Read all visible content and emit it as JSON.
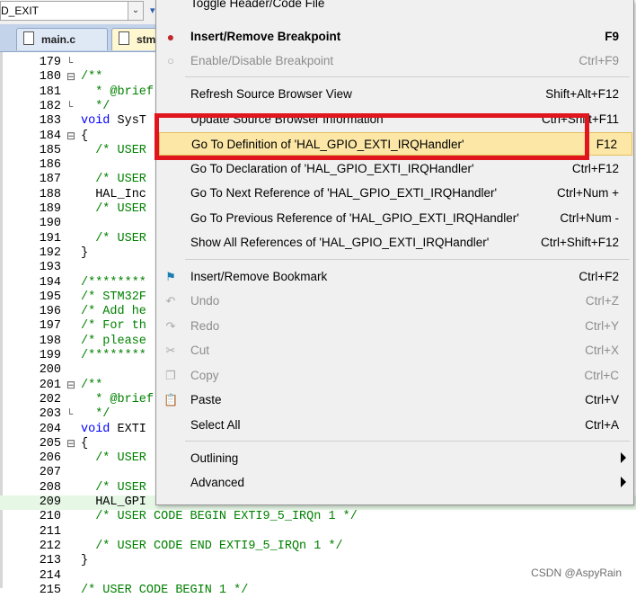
{
  "toolbar": {
    "combo_value": "D_EXIT",
    "combo_arrow": "chevron-down-icon"
  },
  "tabs": [
    {
      "label": "main.c",
      "icon": "document-icon"
    },
    {
      "label": "stm",
      "icon": "document-icon"
    }
  ],
  "code_lines": [
    {
      "n": "179",
      "fold": "└",
      "text": ""
    },
    {
      "n": "180",
      "fold": "⊟",
      "text": "/**"
    },
    {
      "n": "181",
      "fold": "",
      "text": "  * @brief"
    },
    {
      "n": "182",
      "fold": "└",
      "text": "  */"
    },
    {
      "n": "183",
      "fold": "",
      "text": "void SysT"
    },
    {
      "n": "184",
      "fold": "⊟",
      "text": "{"
    },
    {
      "n": "185",
      "fold": "",
      "text": "  /* USER"
    },
    {
      "n": "186",
      "fold": "",
      "text": ""
    },
    {
      "n": "187",
      "fold": "",
      "text": "  /* USER"
    },
    {
      "n": "188",
      "fold": "",
      "text": "  HAL_Inc"
    },
    {
      "n": "189",
      "fold": "",
      "text": "  /* USER"
    },
    {
      "n": "190",
      "fold": "",
      "text": ""
    },
    {
      "n": "191",
      "fold": "",
      "text": "  /* USER"
    },
    {
      "n": "192",
      "fold": "",
      "text": "}"
    },
    {
      "n": "193",
      "fold": "",
      "text": ""
    },
    {
      "n": "194",
      "fold": "",
      "text": "/********"
    },
    {
      "n": "195",
      "fold": "",
      "text": "/* STM32F"
    },
    {
      "n": "196",
      "fold": "",
      "text": "/* Add he"
    },
    {
      "n": "197",
      "fold": "",
      "text": "/* For th"
    },
    {
      "n": "198",
      "fold": "",
      "text": "/* please"
    },
    {
      "n": "199",
      "fold": "",
      "text": "/********"
    },
    {
      "n": "200",
      "fold": "",
      "text": ""
    },
    {
      "n": "201",
      "fold": "⊟",
      "text": "/**"
    },
    {
      "n": "202",
      "fold": "",
      "text": "  * @brief"
    },
    {
      "n": "203",
      "fold": "└",
      "text": "  */"
    },
    {
      "n": "204",
      "fold": "",
      "text": "void EXTI"
    },
    {
      "n": "205",
      "fold": "⊟",
      "text": "{"
    },
    {
      "n": "206",
      "fold": "",
      "text": "  /* USER"
    },
    {
      "n": "207",
      "fold": "",
      "text": ""
    },
    {
      "n": "208",
      "fold": "",
      "text": "  /* USER"
    },
    {
      "n": "209",
      "fold": "",
      "text": "  HAL_GPI"
    },
    {
      "n": "210",
      "fold": "",
      "text": "  /* USER CODE BEGIN EXTI9_5_IRQn 1 */"
    },
    {
      "n": "211",
      "fold": "",
      "text": ""
    },
    {
      "n": "212",
      "fold": "",
      "text": "  /* USER CODE END EXTI9_5_IRQn 1 */"
    },
    {
      "n": "213",
      "fold": "",
      "text": "}"
    },
    {
      "n": "214",
      "fold": "",
      "text": ""
    },
    {
      "n": "215",
      "fold": "",
      "text": "/* USER CODE BEGIN 1 */"
    }
  ],
  "menu": {
    "items": [
      {
        "label": "Toggle Header/Code File",
        "shortcut": ""
      },
      {
        "label": "Insert/Remove Breakpoint",
        "shortcut": "F9",
        "icon": "breakpoint-icon"
      },
      {
        "label": "Enable/Disable Breakpoint",
        "shortcut": "Ctrl+F9",
        "icon": "breakpoint-disabled-icon"
      },
      {
        "label": "Refresh Source Browser View",
        "shortcut": "Shift+Alt+F12"
      },
      {
        "label": "Update Source Browser Information",
        "shortcut": "Ctrl+Shift+F11"
      },
      {
        "label": "Go To Definition of 'HAL_GPIO_EXTI_IRQHandler'",
        "shortcut": "F12"
      },
      {
        "label": "Go To Declaration of 'HAL_GPIO_EXTI_IRQHandler'",
        "shortcut": "Ctrl+F12"
      },
      {
        "label": "Go To Next Reference of 'HAL_GPIO_EXTI_IRQHandler'",
        "shortcut": "Ctrl+Num +"
      },
      {
        "label": "Go To Previous Reference of 'HAL_GPIO_EXTI_IRQHandler'",
        "shortcut": "Ctrl+Num -"
      },
      {
        "label": "Show All References of 'HAL_GPIO_EXTI_IRQHandler'",
        "shortcut": "Ctrl+Shift+F12"
      },
      {
        "label": "Insert/Remove Bookmark",
        "shortcut": "Ctrl+F2",
        "icon": "bookmark-flag-icon"
      },
      {
        "label": "Undo",
        "shortcut": "Ctrl+Z",
        "icon": "undo-icon"
      },
      {
        "label": "Redo",
        "shortcut": "Ctrl+Y",
        "icon": "redo-icon"
      },
      {
        "label": "Cut",
        "shortcut": "Ctrl+X",
        "icon": "scissors-icon"
      },
      {
        "label": "Copy",
        "shortcut": "Ctrl+C",
        "icon": "copy-icon"
      },
      {
        "label": "Paste",
        "shortcut": "Ctrl+V",
        "icon": "paste-icon"
      },
      {
        "label": "Select All",
        "shortcut": "Ctrl+A"
      },
      {
        "label": "Outlining",
        "shortcut": ""
      },
      {
        "label": "Advanced",
        "shortcut": ""
      }
    ]
  },
  "watermark": "CSDN @AspyRain",
  "colors": {
    "highlight_box": "#e0151d",
    "selected_item": "#fce7a6",
    "comment": "#008000",
    "keyword": "#0000ff"
  }
}
